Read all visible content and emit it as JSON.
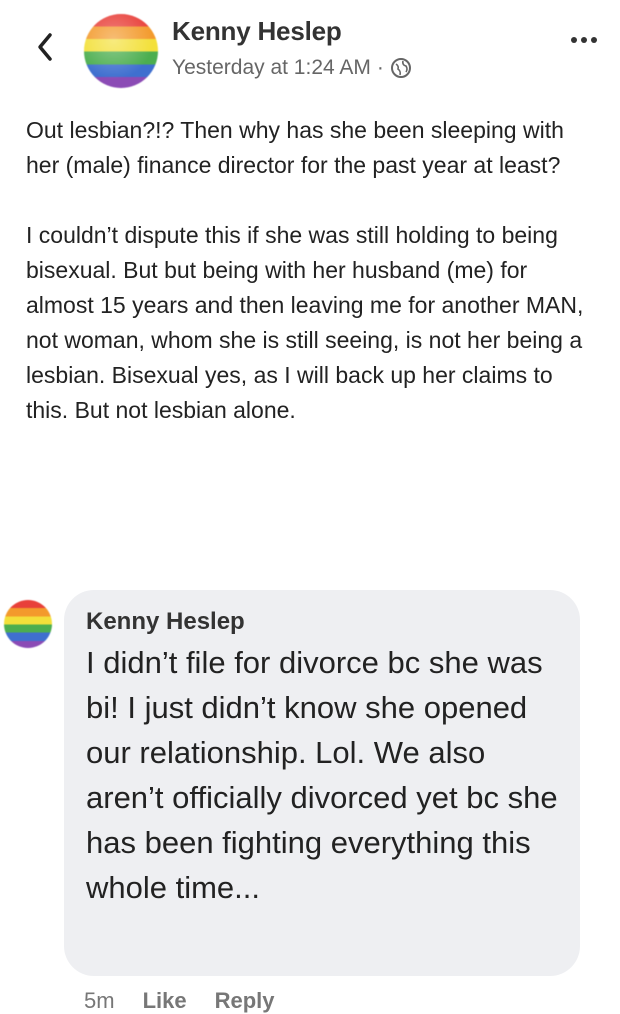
{
  "header": {
    "author": "Kenny Heslep",
    "timestamp": "Yesterday at 1:24 AM",
    "separator": "·",
    "back_icon": "chevron-left-icon",
    "privacy_icon": "globe-icon",
    "more_icon": "ellipsis-icon"
  },
  "post": {
    "paragraphs": [
      "Out lesbian?!? Then why has she been sleeping with her (male) finance director for the past year at least?",
      "I couldn’t dispute this if she was still holding to being bisexual. But but being with her husband (me) for almost 15 years and then leaving me for another MAN, not woman, whom she is still seeing, is not her being a lesbian. Bisexual yes, as I will back up her claims to this. But not lesbian alone."
    ]
  },
  "comment": {
    "author": "Kenny Heslep",
    "text": "I didn’t file for divorce bc she was bi! I just didn’t know she opened our relationship. Lol. We also aren’t officially divorced yet bc she has been fighting everything this whole time...",
    "time": "5m",
    "like_label": "Like",
    "reply_label": "Reply"
  },
  "colors": {
    "bubble": "#eeeff2",
    "text": "#222222",
    "meta": "#666666"
  }
}
